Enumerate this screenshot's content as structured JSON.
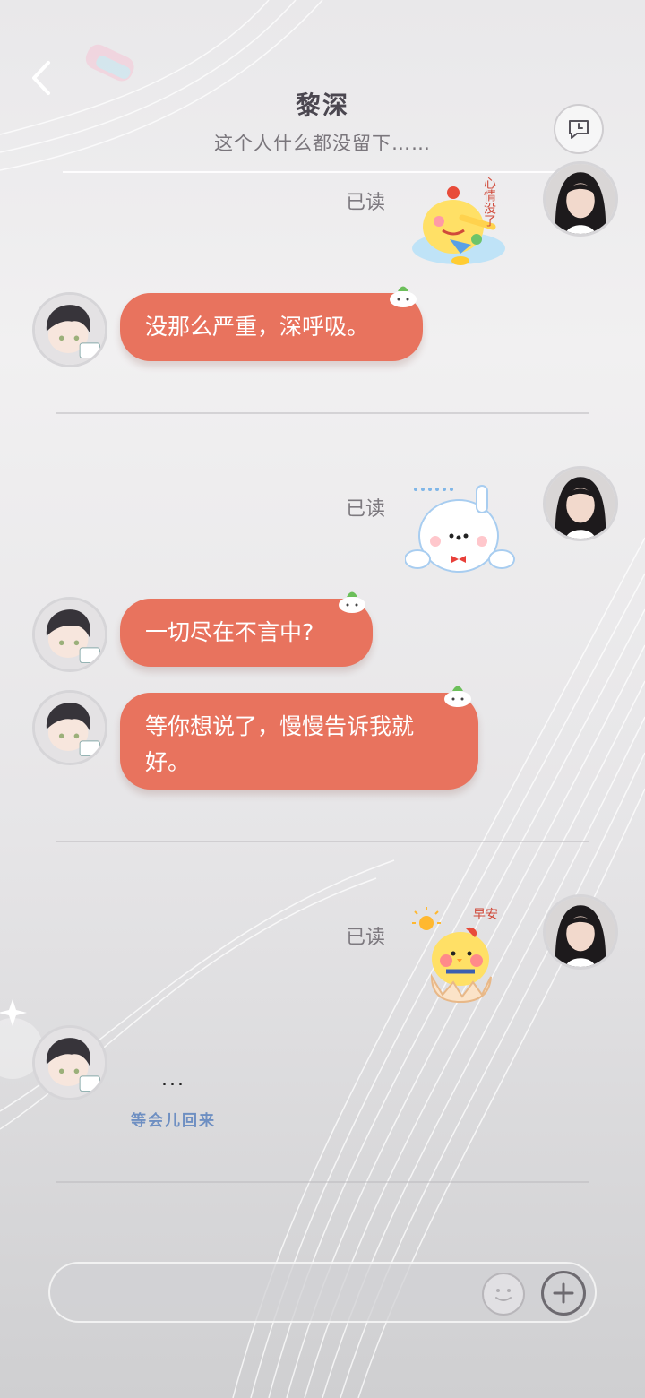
{
  "header": {
    "title": "黎深",
    "subtitle": "这个人什么都没留下……"
  },
  "messages": [
    {
      "type": "sticker",
      "from": "me",
      "read_label": "已读",
      "sticker": "crying-chick-sticker",
      "sticker_text": "心情没了"
    },
    {
      "type": "text",
      "from": "contact",
      "text": "没那么严重，深呼吸。"
    },
    {
      "type": "sticker",
      "from": "me",
      "read_label": "已读",
      "sticker": "snowman-sticker"
    },
    {
      "type": "text",
      "from": "contact",
      "text": "一切尽在不言中?"
    },
    {
      "type": "text",
      "from": "contact",
      "text": "等你想说了，慢慢告诉我就好。"
    },
    {
      "type": "sticker",
      "from": "me",
      "read_label": "已读",
      "sticker": "good-morning-chick-sticker",
      "sticker_text": "早安"
    },
    {
      "type": "typing",
      "from": "contact",
      "text": "...",
      "status_sticker_text": "等会儿回来"
    }
  ],
  "input": {
    "placeholder": "",
    "emoji_icon": "smiley-icon",
    "plus_icon": "plus-icon"
  },
  "colors": {
    "bubble": "#e8735e",
    "title": "#4b4750"
  }
}
